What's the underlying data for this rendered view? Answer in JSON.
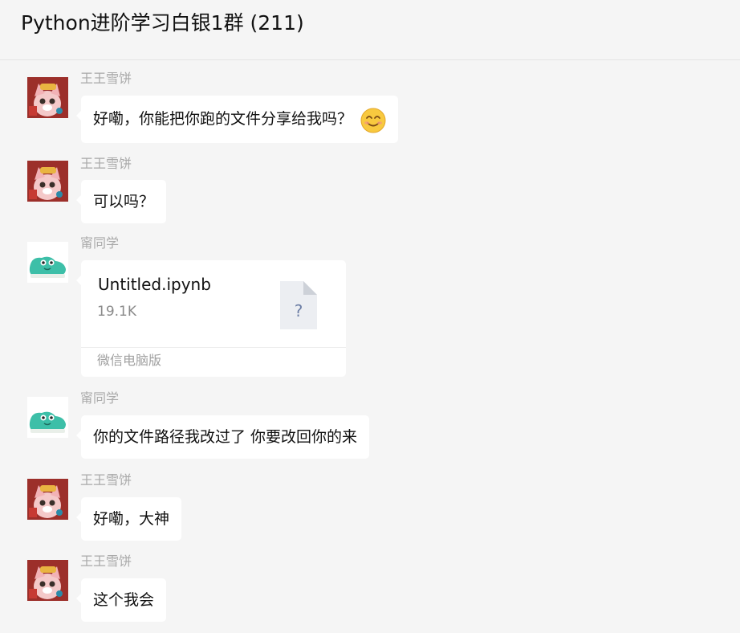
{
  "header": {
    "title": "Python进阶学习白银1群 (211)"
  },
  "colors": {
    "background": "#f5f5f5",
    "bubble": "#ffffff",
    "sender_name": "#a9a9a9",
    "title_text": "#111111"
  },
  "messages": [
    {
      "sender": "王王雪饼",
      "avatar": "fox-character-avatar-icon",
      "text": "好嘞，你能把你跑的文件分享给我吗？",
      "emoji": "smiling-face-emoji-icon"
    },
    {
      "sender": "王王雪饼",
      "avatar": "fox-character-avatar-icon",
      "text": "可以吗？"
    },
    {
      "sender": "甯同学",
      "avatar": "green-shoe-avatar-icon",
      "file": {
        "name": "Untitled.ipynb",
        "size": "19.1K",
        "icon": "unknown-file-icon",
        "icon_glyph": "?",
        "source": "微信电脑版"
      }
    },
    {
      "sender": "甯同学",
      "avatar": "green-shoe-avatar-icon",
      "text": "你的文件路径我改过了 你要改回你的来"
    },
    {
      "sender": "王王雪饼",
      "avatar": "fox-character-avatar-icon",
      "text": "好嘞，大神"
    },
    {
      "sender": "王王雪饼",
      "avatar": "fox-character-avatar-icon",
      "text": "这个我会"
    }
  ]
}
